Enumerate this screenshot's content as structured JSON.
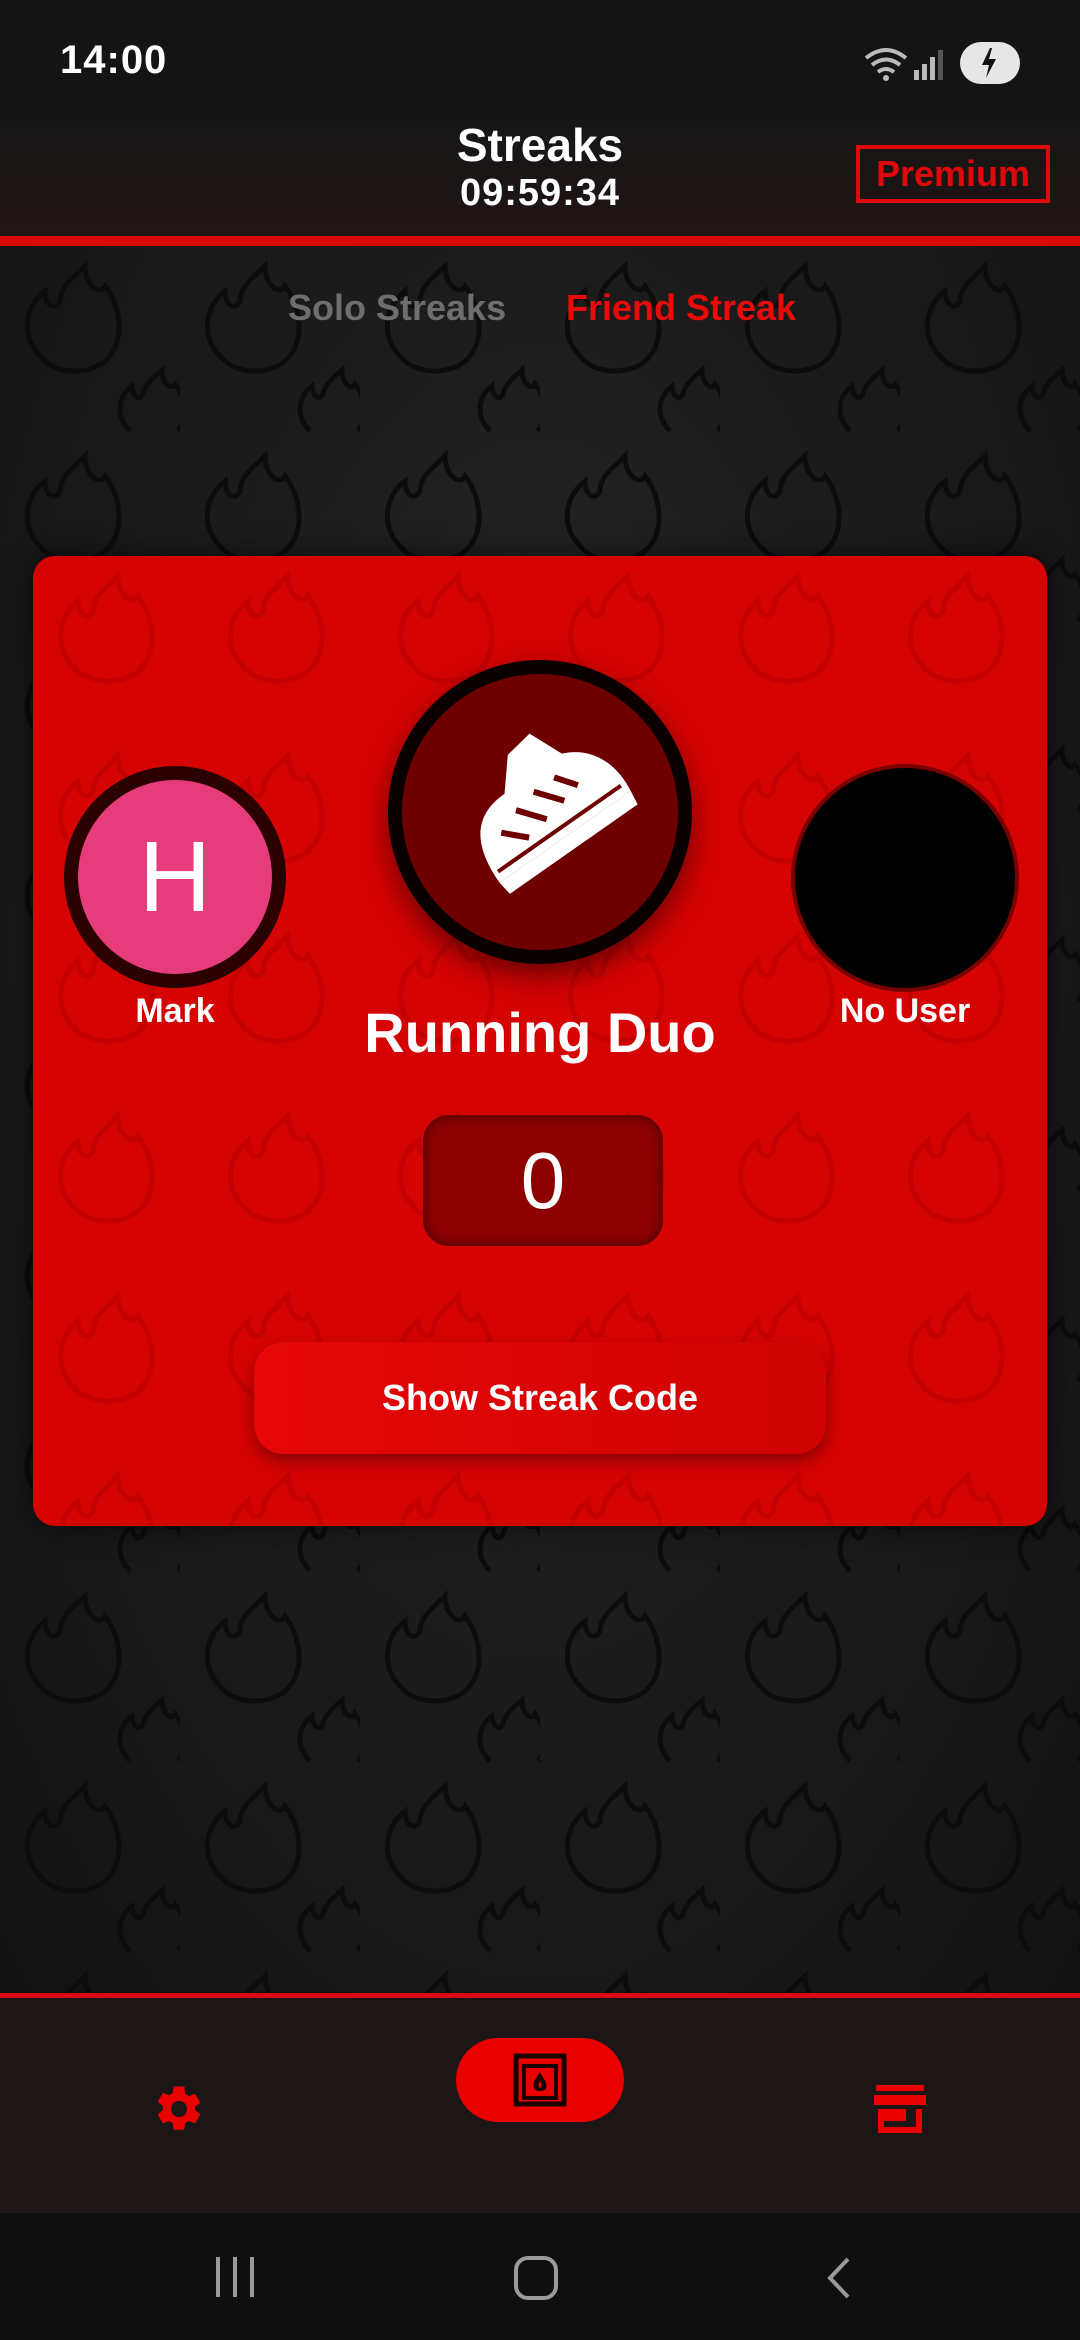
{
  "status_bar": {
    "time": "14:00",
    "icons": [
      "wifi-icon",
      "signal-icon",
      "battery-charging-icon"
    ]
  },
  "header": {
    "title": "Streaks",
    "timer": "09:59:34",
    "premium_label": "Premium"
  },
  "tabs": [
    {
      "label": "Solo Streaks",
      "active": false
    },
    {
      "label": "Friend Streak",
      "active": true
    }
  ],
  "streak_card": {
    "title": "Running Duo",
    "count": "0",
    "icon": "running-shoe-icon",
    "left_user": {
      "initial": "H",
      "name": "Mark"
    },
    "right_user": {
      "name": "No User"
    },
    "button_label": "Show Streak Code"
  },
  "bottom_nav": {
    "items": [
      {
        "icon": "gear-icon",
        "active": false
      },
      {
        "icon": "fireplace-icon",
        "active": true
      },
      {
        "icon": "store-icon",
        "active": false
      }
    ]
  },
  "colors": {
    "accent": "#d80a0a",
    "card": "#d60303",
    "avatar_pink": "#e73c7c",
    "inactive_tab": "#6e6e6e"
  }
}
